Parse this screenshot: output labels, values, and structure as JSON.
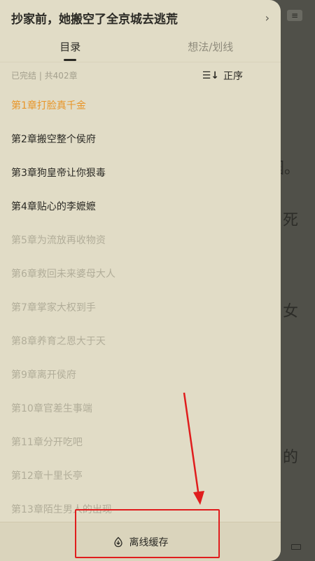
{
  "reader": {
    "menu_icon": "menu-icon",
    "text_fragments": [
      "园。",
      "死",
      "女",
      "的"
    ]
  },
  "drawer": {
    "book_title": "抄家前，她搬空了全京城去逃荒",
    "tabs": [
      {
        "label": "目录",
        "active": true
      },
      {
        "label": "想法/划线",
        "active": false
      }
    ],
    "status_text": "已完结 | 共402章",
    "sort_label": "正序",
    "chapters": [
      {
        "label": "第1章打脸真千金",
        "state": "current"
      },
      {
        "label": "第2章搬空整个侯府",
        "state": "read"
      },
      {
        "label": "第3章狗皇帝让你狠毒",
        "state": "read"
      },
      {
        "label": "第4章贴心的李嬷嬷",
        "state": "read"
      },
      {
        "label": "第5章为流放再收物资",
        "state": "unread"
      },
      {
        "label": "第6章救回未来婆母大人",
        "state": "unread"
      },
      {
        "label": "第7章掌家大权到手",
        "state": "unread"
      },
      {
        "label": "第8章养育之恩大于天",
        "state": "unread"
      },
      {
        "label": "第9章离开侯府",
        "state": "unread"
      },
      {
        "label": "第10章官差生事端",
        "state": "unread"
      },
      {
        "label": "第11章分开吃吧",
        "state": "unread"
      },
      {
        "label": "第12章十里长亭",
        "state": "unread"
      },
      {
        "label": "第13章陌生男人的出现",
        "state": "unread"
      }
    ],
    "offline_label": "离线缓存"
  },
  "colors": {
    "accent": "#e8962a",
    "annotation": "#e01d1d",
    "panel_bg": "#e1dcc6"
  }
}
